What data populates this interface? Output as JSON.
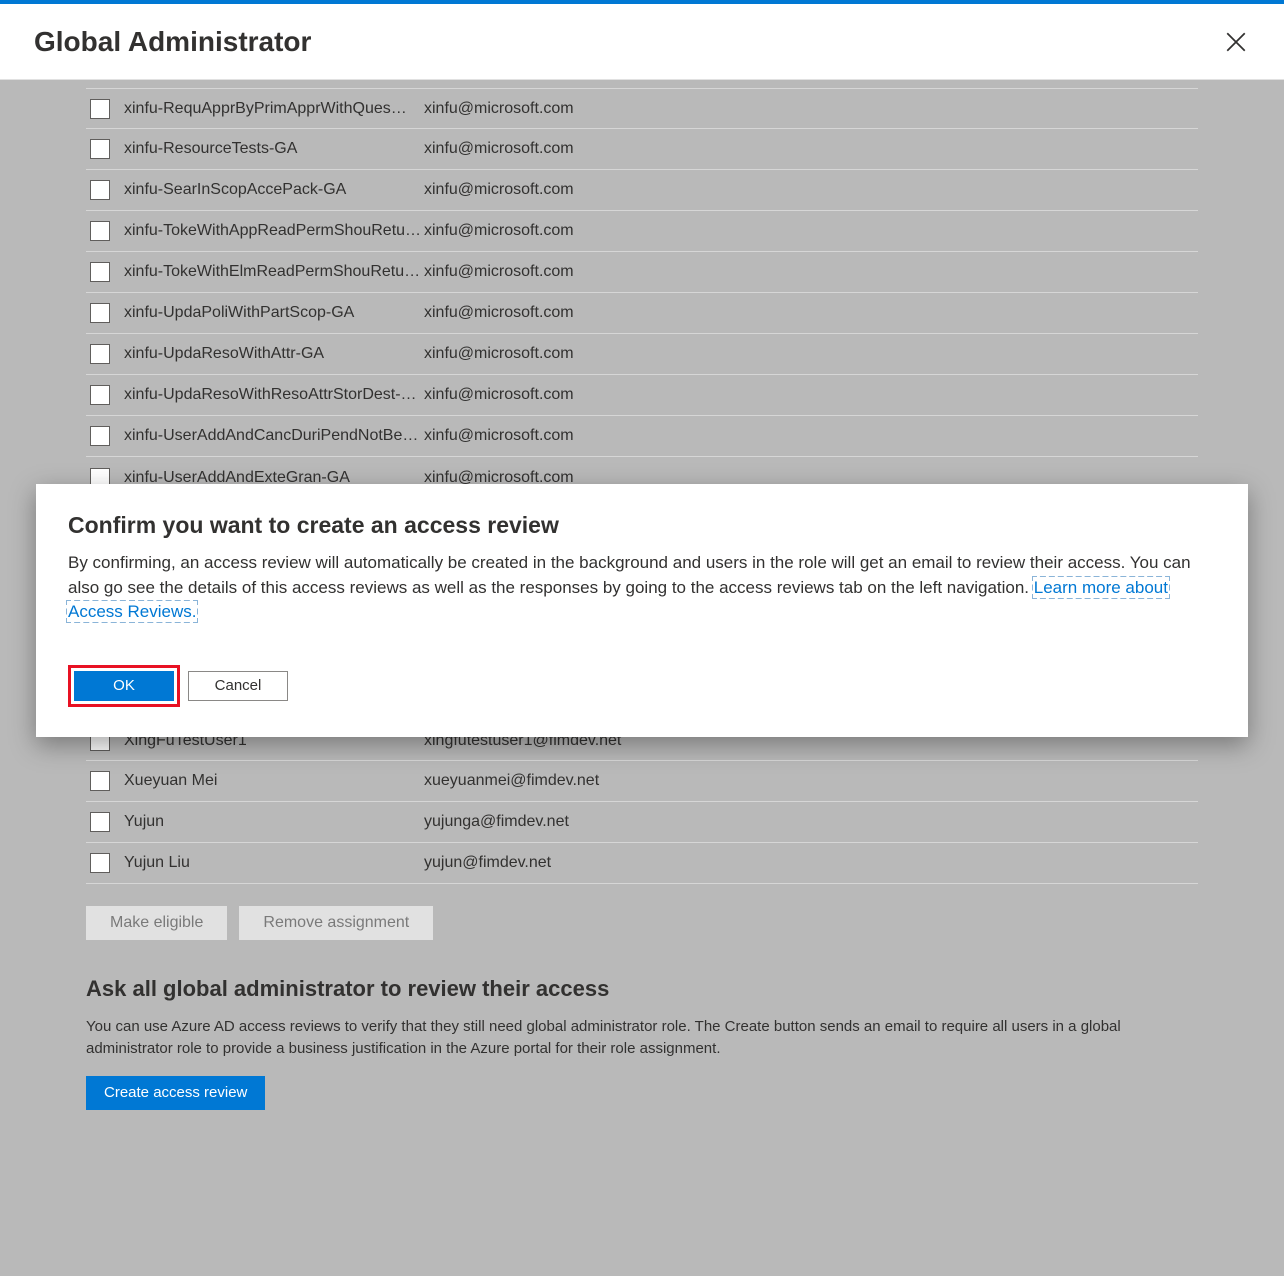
{
  "header": {
    "title": "Global Administrator"
  },
  "users_top": [
    {
      "name": "xinfu-RequApprByPrimApprWithQues…",
      "email": "xinfu@microsoft.com"
    },
    {
      "name": "xinfu-ResourceTests-GA",
      "email": "xinfu@microsoft.com"
    },
    {
      "name": "xinfu-SearInScopAccePack-GA",
      "email": "xinfu@microsoft.com"
    },
    {
      "name": "xinfu-TokeWithAppReadPermShouRetu…",
      "email": "xinfu@microsoft.com"
    },
    {
      "name": "xinfu-TokeWithElmReadPermShouRetu…",
      "email": "xinfu@microsoft.com"
    },
    {
      "name": "xinfu-UpdaPoliWithPartScop-GA",
      "email": "xinfu@microsoft.com"
    },
    {
      "name": "xinfu-UpdaResoWithAttr-GA",
      "email": "xinfu@microsoft.com"
    },
    {
      "name": "xinfu-UpdaResoWithResoAttrStorDest-…",
      "email": "xinfu@microsoft.com"
    },
    {
      "name": "xinfu-UserAddAndCancDuriPendNotBe…",
      "email": "xinfu@microsoft.com"
    },
    {
      "name": "xinfu-UserAddAndExteGran-GA",
      "email": "xinfu@microsoft.com"
    }
  ],
  "users_bottom": [
    {
      "name": "XingFuTestUser1",
      "email": "xingfutestuser1@fimdev.net"
    },
    {
      "name": "Xueyuan Mei",
      "email": "xueyuanmei@fimdev.net"
    },
    {
      "name": "Yujun",
      "email": "yujunga@fimdev.net"
    },
    {
      "name": "Yujun Liu",
      "email": "yujun@fimdev.net"
    }
  ],
  "actions": {
    "make_eligible": "Make eligible",
    "remove_assignment": "Remove assignment"
  },
  "review_section": {
    "title": "Ask all global administrator to review their access",
    "desc": "You can use Azure AD access reviews to verify that they still need global administrator role. The Create button sends an email to require all users in a global administrator role to provide a business justification in the Azure portal for their role assignment.",
    "button": "Create access review"
  },
  "dialog": {
    "title": "Confirm you want to create an access review",
    "desc": "By confirming, an access review will automatically be created in the background and users in the role will get an email to review their access. You can also go see the details of this access reviews as well as the responses by going to the access reviews tab on the left navigation. ",
    "link": "Learn more about Access Reviews.",
    "ok": "OK",
    "cancel": "Cancel"
  }
}
